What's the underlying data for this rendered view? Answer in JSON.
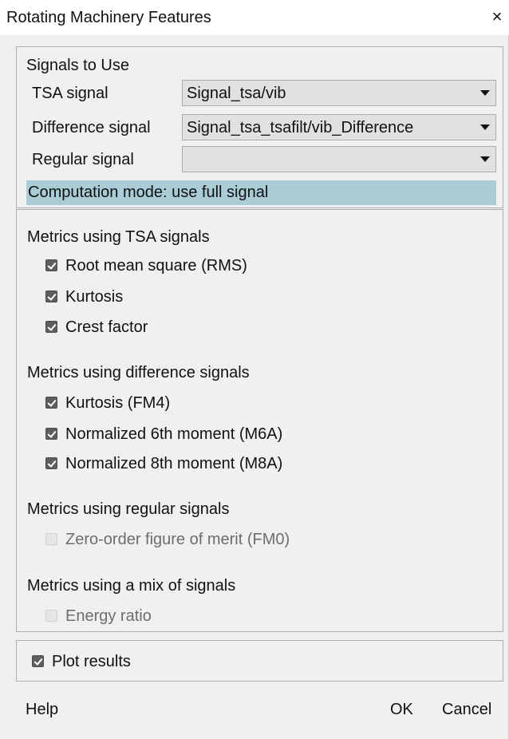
{
  "window": {
    "title": "Rotating Machinery Features",
    "close_label": "×"
  },
  "signals": {
    "heading": "Signals to Use",
    "tsa_label": "TSA signal",
    "tsa_value": "Signal_tsa/vib",
    "difference_label": "Difference signal",
    "difference_value": "Signal_tsa_tsafilt/vib_Difference",
    "regular_label": "Regular signal",
    "regular_value": "",
    "computation_mode": "Computation mode: use full signal"
  },
  "metrics": {
    "tsa": {
      "heading": "Metrics using TSA signals",
      "items": [
        {
          "label": "Root mean square (RMS)",
          "checked": true,
          "enabled": true
        },
        {
          "label": "Kurtosis",
          "checked": true,
          "enabled": true
        },
        {
          "label": "Crest factor",
          "checked": true,
          "enabled": true
        }
      ]
    },
    "difference": {
      "heading": "Metrics using difference signals",
      "items": [
        {
          "label": "Kurtosis (FM4)",
          "checked": true,
          "enabled": true
        },
        {
          "label": "Normalized 6th moment (M6A)",
          "checked": true,
          "enabled": true
        },
        {
          "label": "Normalized 8th moment (M8A)",
          "checked": true,
          "enabled": true
        }
      ]
    },
    "regular": {
      "heading": "Metrics using regular signals",
      "items": [
        {
          "label": "Zero-order figure of merit (FM0)",
          "checked": false,
          "enabled": false
        }
      ]
    },
    "mix": {
      "heading": "Metrics using a mix of signals",
      "items": [
        {
          "label": "Energy ratio",
          "checked": false,
          "enabled": false
        }
      ]
    }
  },
  "plot": {
    "label": "Plot results",
    "checked": true
  },
  "footer": {
    "help_label": "Help",
    "ok_label": "OK",
    "cancel_label": "Cancel"
  },
  "colors": {
    "mode_bar": "#a9ccd6",
    "checkbox_checked": "#5e5e5e",
    "checkbox_disabled": "#e6e6e6",
    "combo_background": "#e1e1e1"
  }
}
